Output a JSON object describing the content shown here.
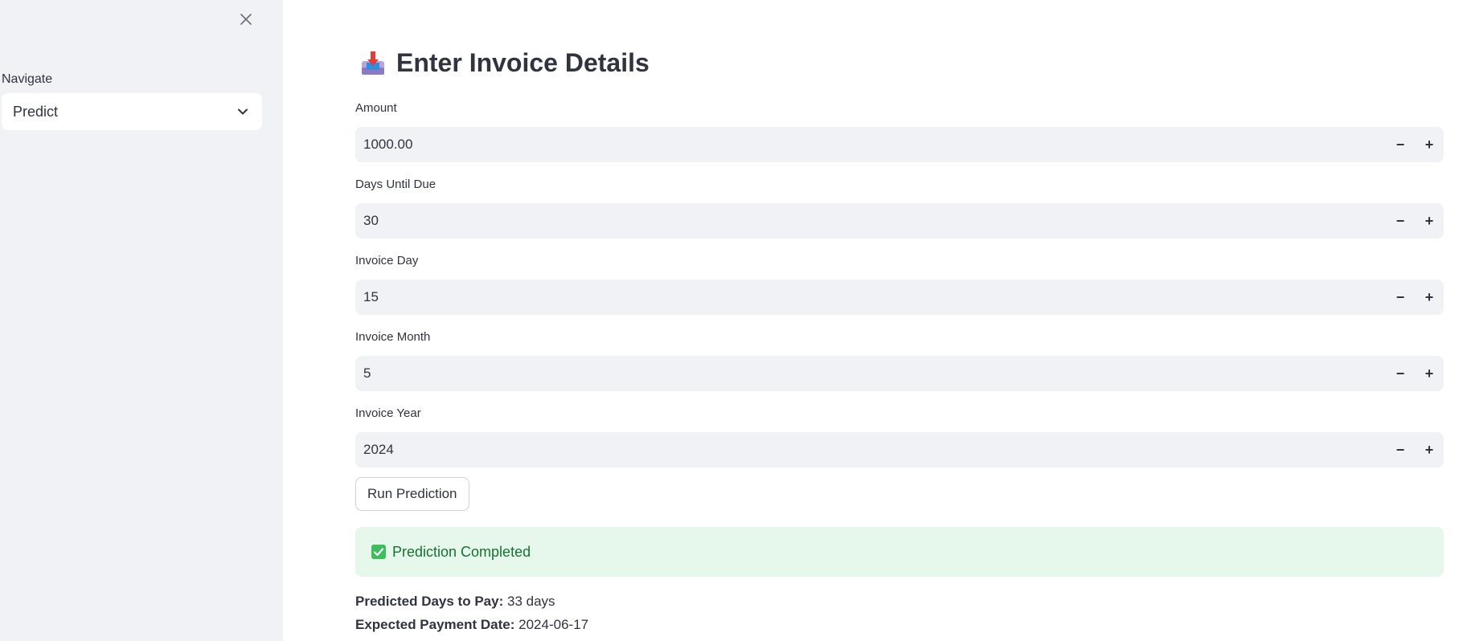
{
  "sidebar": {
    "nav_label": "Navigate",
    "nav_selected": "Predict"
  },
  "main": {
    "title": "Enter Invoice Details",
    "fields": [
      {
        "label": "Amount",
        "value": "1000.00"
      },
      {
        "label": "Days Until Due",
        "value": "30"
      },
      {
        "label": "Invoice Day",
        "value": "15"
      },
      {
        "label": "Invoice Month",
        "value": "5"
      },
      {
        "label": "Invoice Year",
        "value": "2024"
      }
    ],
    "stepper_minus": "−",
    "stepper_plus": "+",
    "run_button": "Run Prediction",
    "success_message": "Prediction Completed",
    "result": {
      "days_label": "Predicted Days to Pay:",
      "days_value": "33 days",
      "date_label": "Expected Payment Date:",
      "date_value": "2024-06-17"
    }
  },
  "colors": {
    "sidebar_bg": "#f0f2f6",
    "input_bg": "#f0f2f6",
    "success_bg": "#e6f7ec",
    "success_text": "#177233",
    "check_green": "#3dbd5d"
  },
  "icons": {
    "close": "close-icon",
    "chevron": "chevron-down-icon",
    "title": "inbox-tray-icon",
    "success": "check-mark-button-icon"
  }
}
